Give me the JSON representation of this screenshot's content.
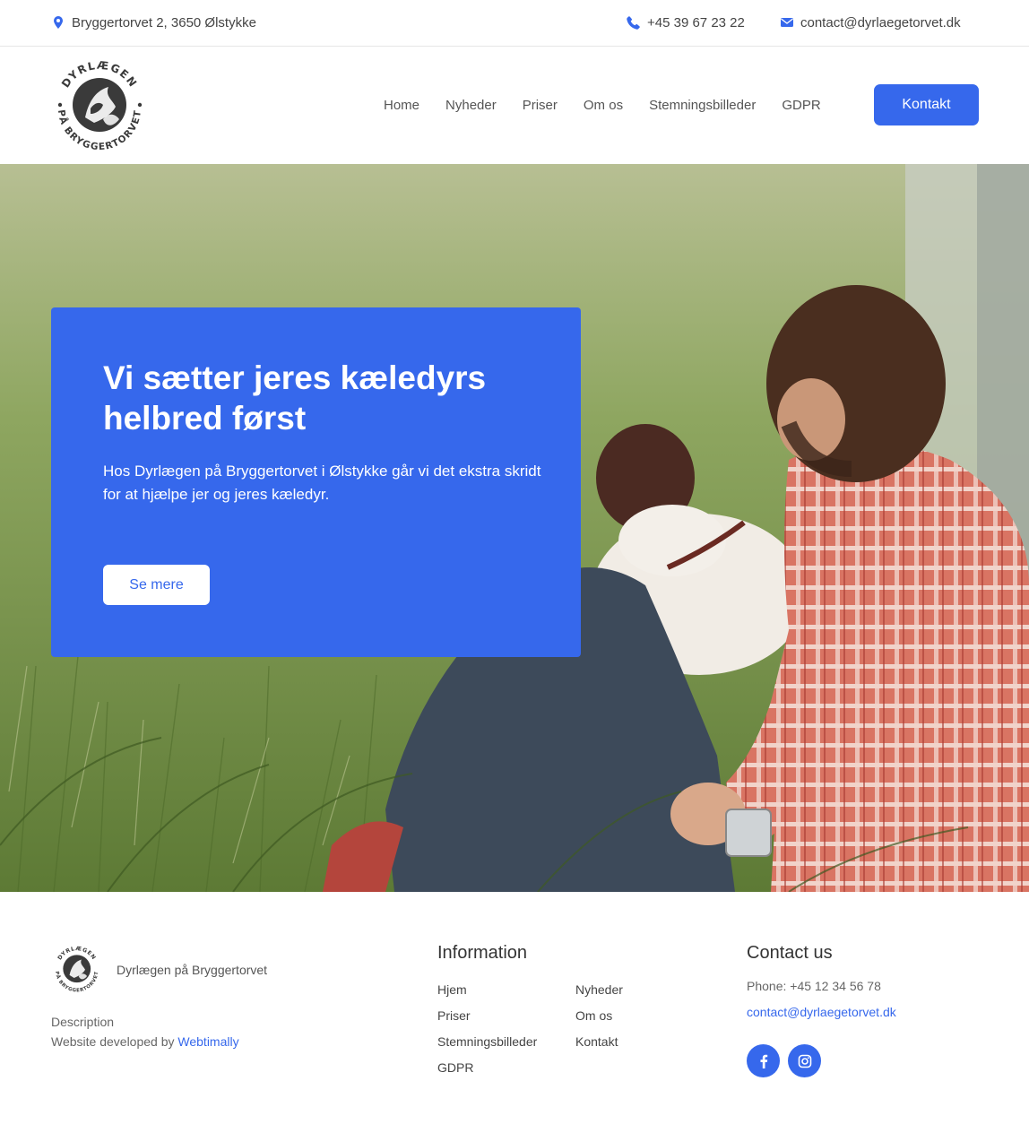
{
  "topbar": {
    "address": "Bryggertorvet 2, 3650 Ølstykke",
    "phone": "+45 39 67 23 22",
    "email": "contact@dyrlaegetorvet.dk",
    "icons": [
      "map-pin-icon",
      "phone-icon",
      "envelope-icon"
    ]
  },
  "header": {
    "logo_text_top": "DYRLÆGEN",
    "logo_text_bottom": "PÅ BRYGGERTORVET",
    "nav": [
      "Home",
      "Nyheder",
      "Priser",
      "Om os",
      "Stemningsbilleder",
      "GDPR"
    ],
    "cta": "Kontakt"
  },
  "hero": {
    "title": "Vi sætter jeres kæledyrs helbred først",
    "text": "Hos Dyrlægen på Bryggertorvet i Ølstykke går vi det ekstra skridt for at hjælpe jer og jeres kæledyr.",
    "button": "Se mere"
  },
  "footer": {
    "brand": "Dyrlægen på Bryggertorvet",
    "description": "Description",
    "developed_prefix": "Website developed by ",
    "developed_link": "Webtimally",
    "info_heading": "Information",
    "info_links": {
      "col1": [
        "Hjem",
        "Priser",
        "Stemningsbilleder",
        "GDPR"
      ],
      "col2": [
        "Nyheder",
        "Om os",
        "Kontakt"
      ]
    },
    "contact_heading": "Contact us",
    "phone": "Phone: +45 12 34 56 78",
    "email": "contact@dyrlaegetorvet.dk",
    "social": [
      "facebook-icon",
      "instagram-icon"
    ]
  },
  "colors": {
    "accent": "#3668ec",
    "text": "#333333",
    "muted": "#666666"
  }
}
